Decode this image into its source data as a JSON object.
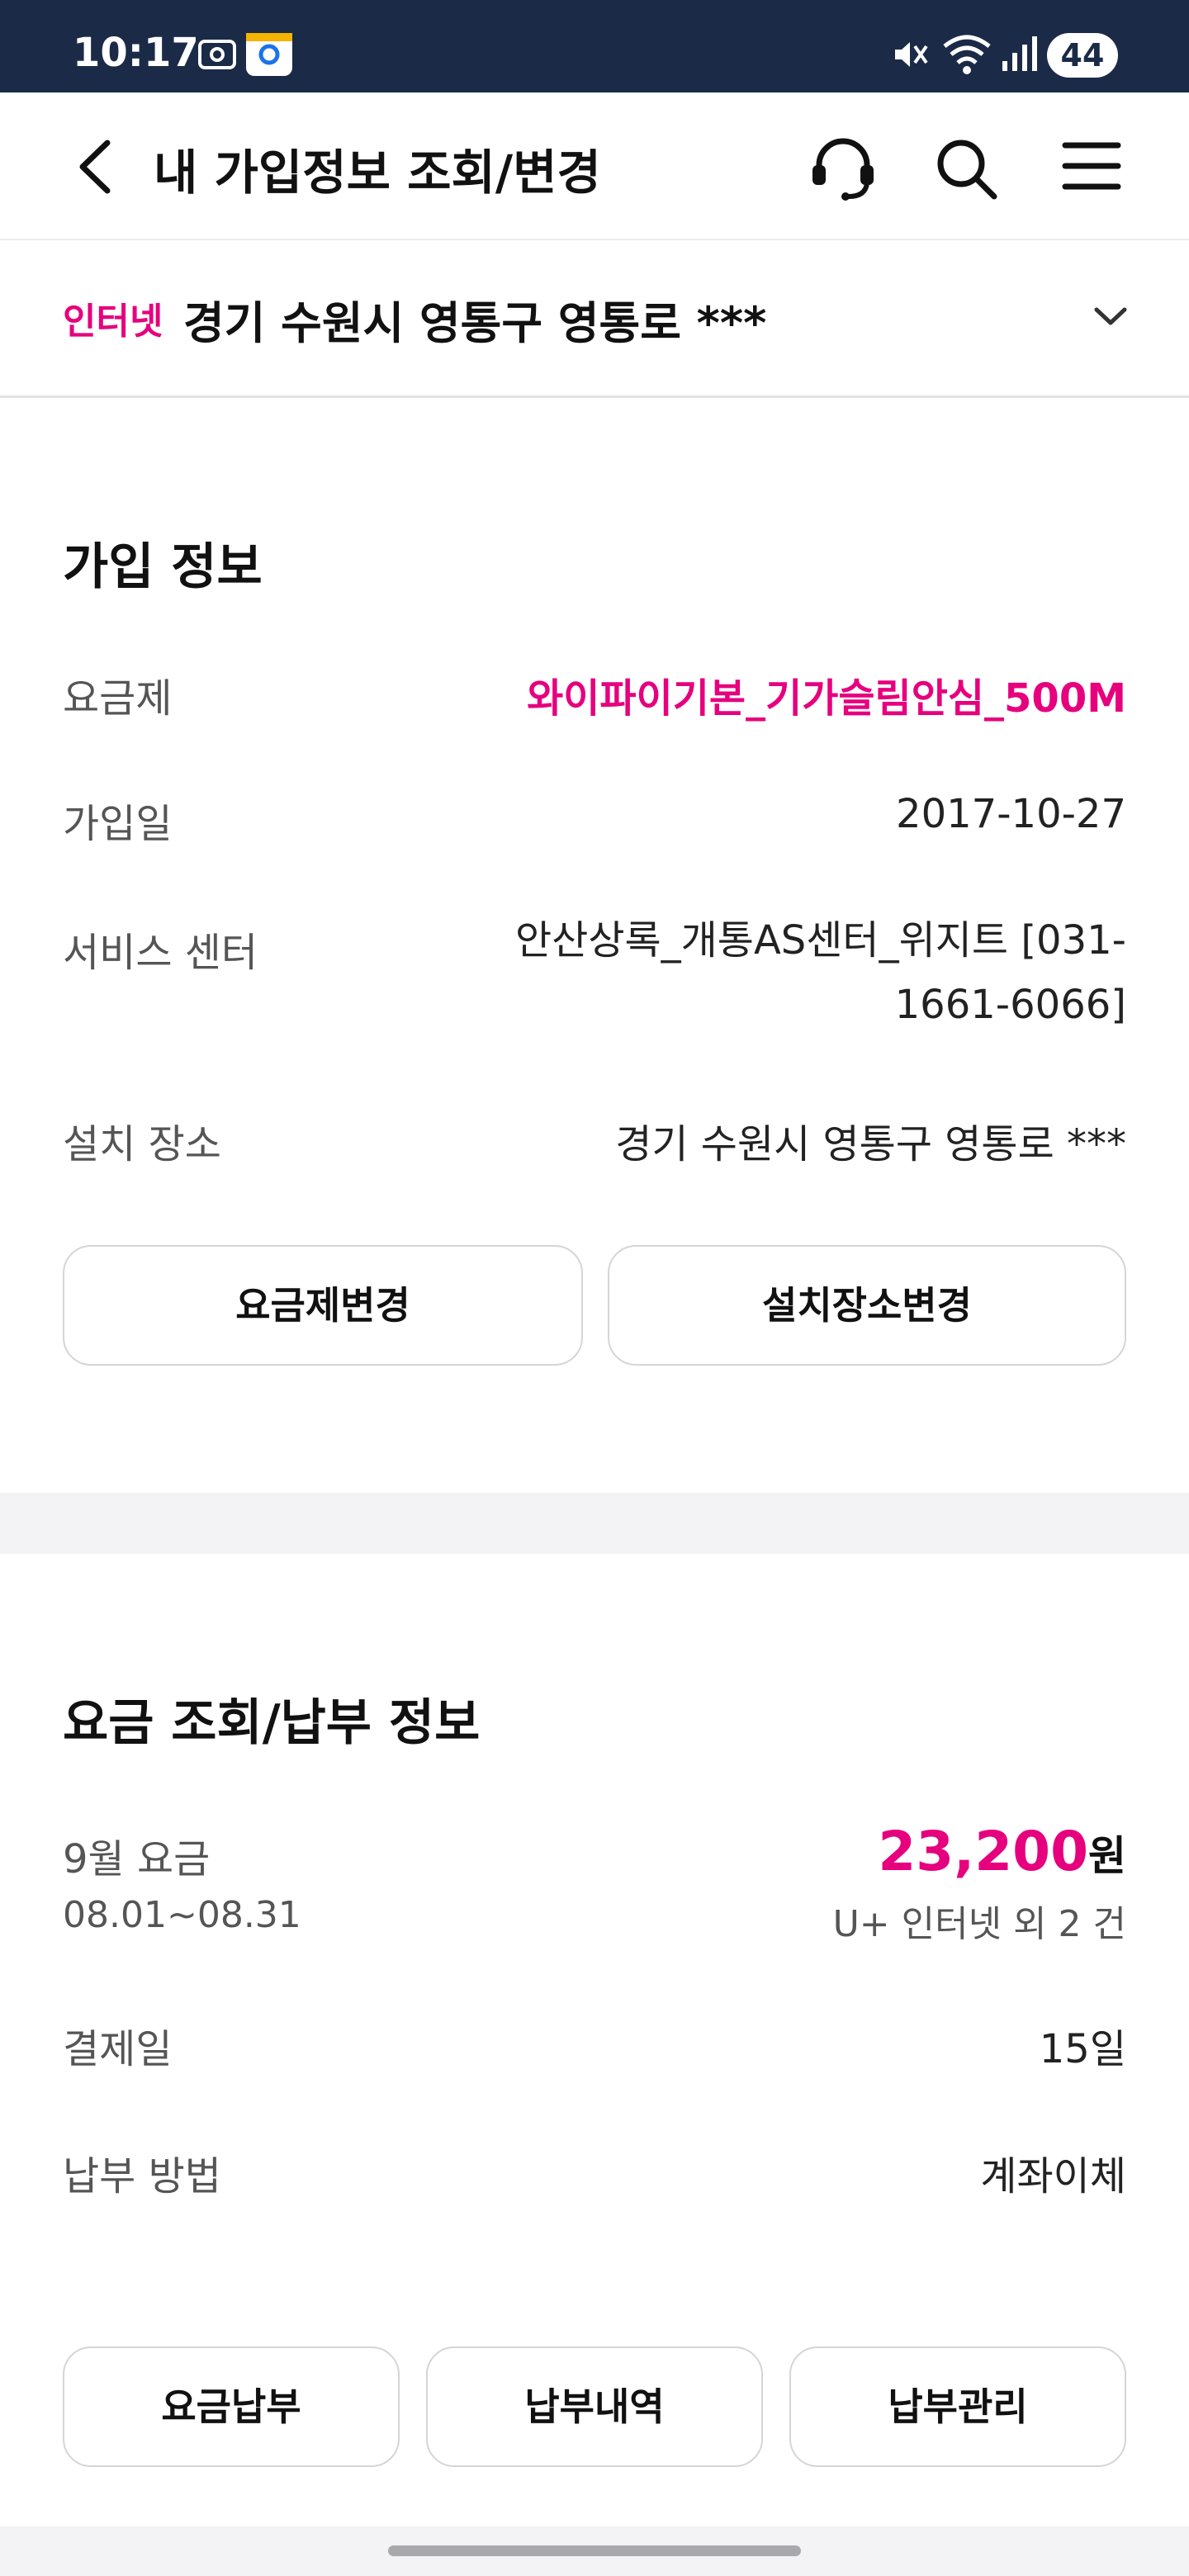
{
  "status_bar": {
    "time": "10:17",
    "battery": "44",
    "icons": [
      "screenshot-icon",
      "app-icon",
      "mute-icon",
      "wifi-icon",
      "signal-icon"
    ]
  },
  "header": {
    "title": "내 가입정보 조회/변경",
    "icons": [
      "back-icon",
      "headset-icon",
      "search-icon",
      "menu-icon"
    ]
  },
  "service_selector": {
    "type": "인터넷",
    "address": "경기 수원시 영통구 영통로 ***"
  },
  "subscription": {
    "title": "가입 정보",
    "rows": [
      {
        "label": "요금제",
        "value": "와이파이기본_기가슬림안심_500M"
      },
      {
        "label": "가입일",
        "value": "2017-10-27"
      },
      {
        "label": "서비스 센터",
        "value": "안산상록_개통AS센터_위지트 [031-1661-6066]"
      },
      {
        "label": "설치 장소",
        "value": "경기 수원시 영통구 영통로 ***"
      }
    ],
    "buttons": [
      "요금제변경",
      "설치장소변경"
    ]
  },
  "billing": {
    "title": "요금 조회/납부 정보",
    "month_label": "9월 요금",
    "period": "08.01~08.31",
    "amount": "23,200",
    "unit": "원",
    "items": "U+ 인터넷 외 2 건",
    "rows": [
      {
        "label": "결제일",
        "value": "15일"
      },
      {
        "label": "납부 방법",
        "value": "계좌이체"
      }
    ],
    "buttons": [
      "요금납부",
      "납부내역",
      "납부관리"
    ]
  },
  "colors": {
    "accent": "#e6007e",
    "status_bar": "#1b2a47",
    "background": "#f3f3f5"
  }
}
